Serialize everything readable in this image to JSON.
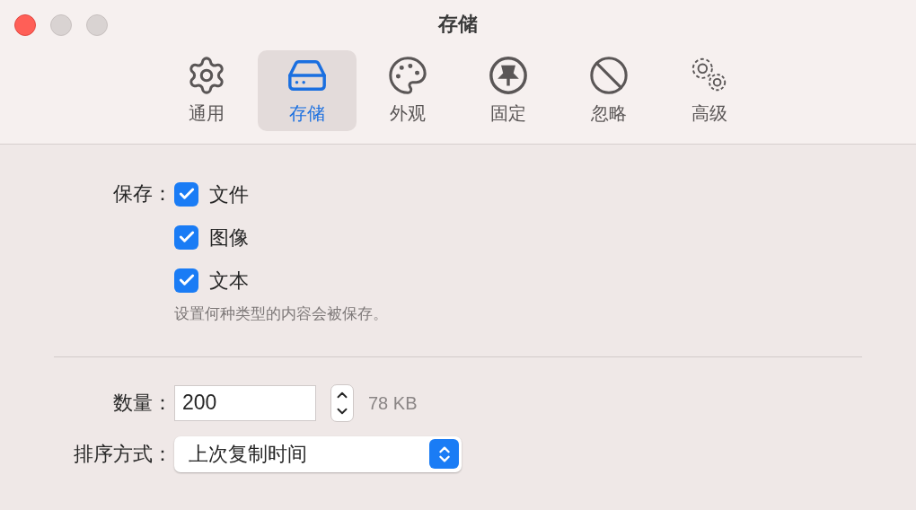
{
  "window": {
    "title": "存储"
  },
  "tabs": [
    {
      "label": "通用",
      "selected": false
    },
    {
      "label": "存储",
      "selected": true
    },
    {
      "label": "外观",
      "selected": false
    },
    {
      "label": "固定",
      "selected": false
    },
    {
      "label": "忽略",
      "selected": false
    },
    {
      "label": "高级",
      "selected": false
    }
  ],
  "save": {
    "label": "保存：",
    "options": [
      {
        "label": "文件",
        "checked": true
      },
      {
        "label": "图像",
        "checked": true
      },
      {
        "label": "文本",
        "checked": true
      }
    ],
    "hint": "设置何种类型的内容会被保存。"
  },
  "count": {
    "label": "数量：",
    "value": "200",
    "size": "78 KB"
  },
  "sort": {
    "label": "排序方式：",
    "value": "上次复制时间"
  }
}
